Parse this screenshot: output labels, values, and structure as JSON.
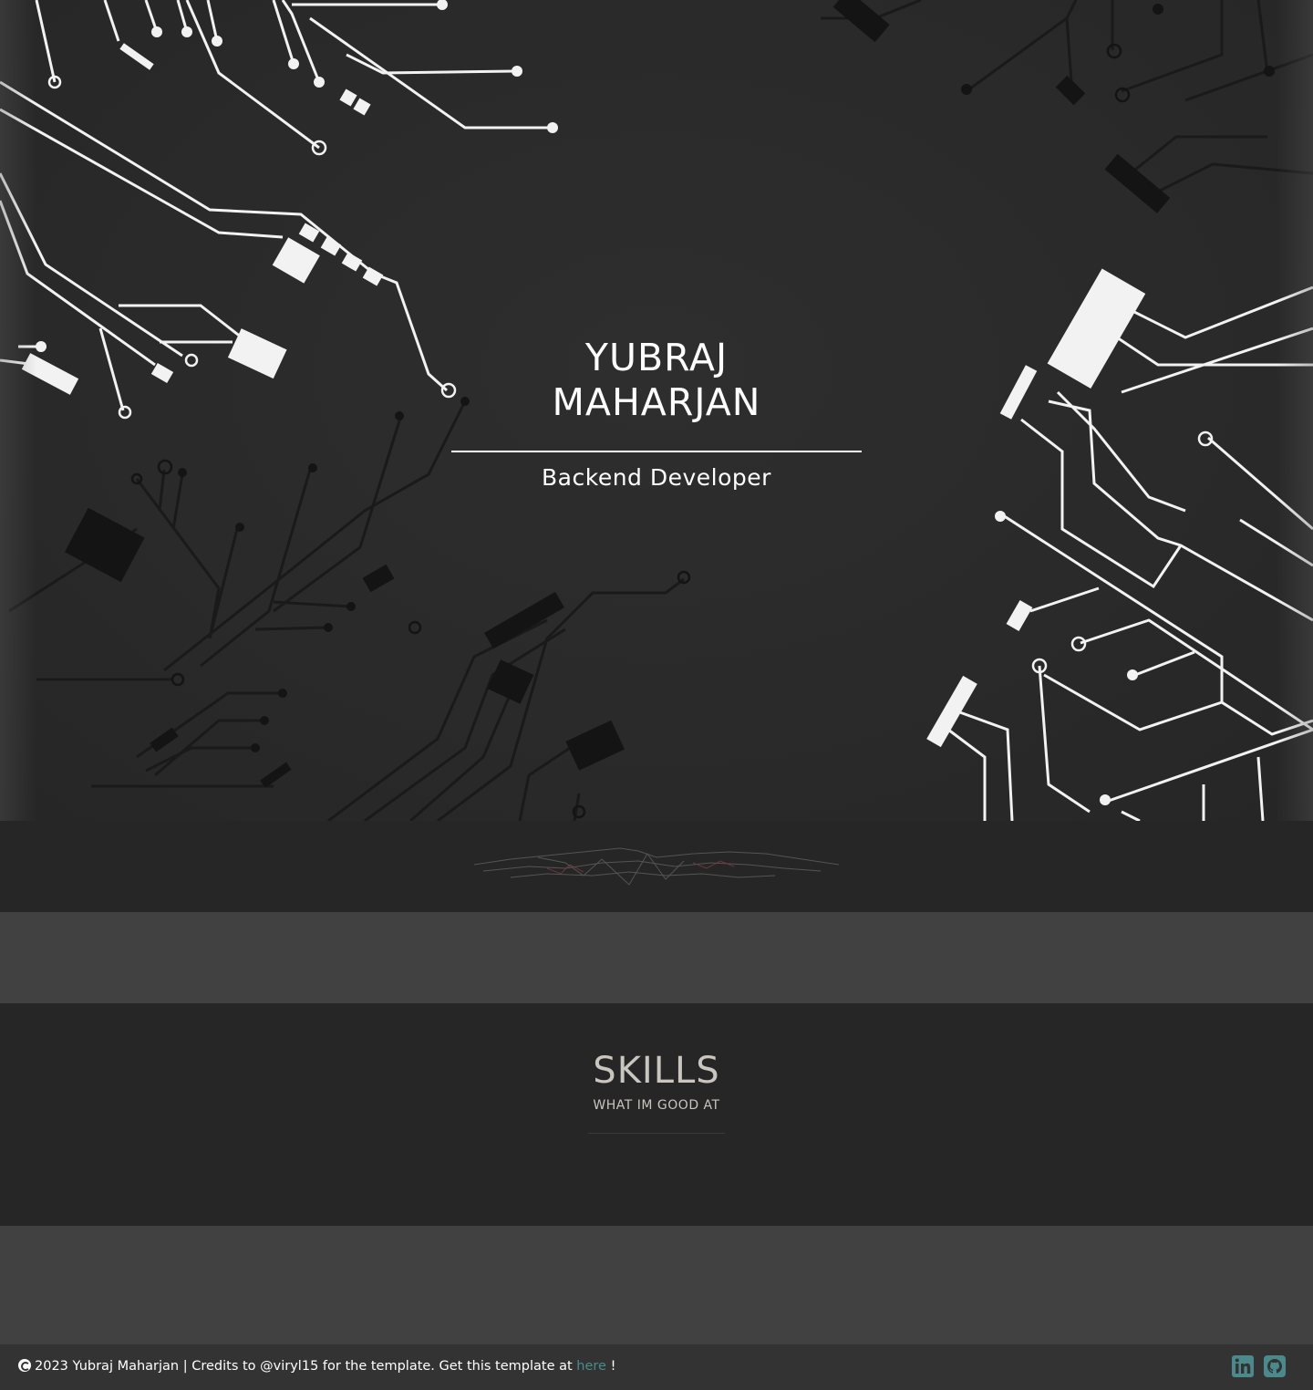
{
  "hero": {
    "name_line1": "YUBRAJ",
    "name_line2": "MAHARJAN",
    "role": "Backend Developer"
  },
  "skills": {
    "title": "SKILLS",
    "subtitle": "WHAT IM GOOD AT"
  },
  "footer": {
    "text_before_link": "2023 Yubraj Maharjan | Credits to @viryl15 for the template. Get this template at ",
    "link_text": "here",
    "text_after_link": " !",
    "icons": [
      "copyright-icon",
      "linkedin-icon",
      "github-icon"
    ]
  },
  "colors": {
    "background": "#262626",
    "section_gray": "#414141",
    "footer_bg": "#333333",
    "accent": "#4a8a8c",
    "skills_text": "#c9c5bf"
  }
}
